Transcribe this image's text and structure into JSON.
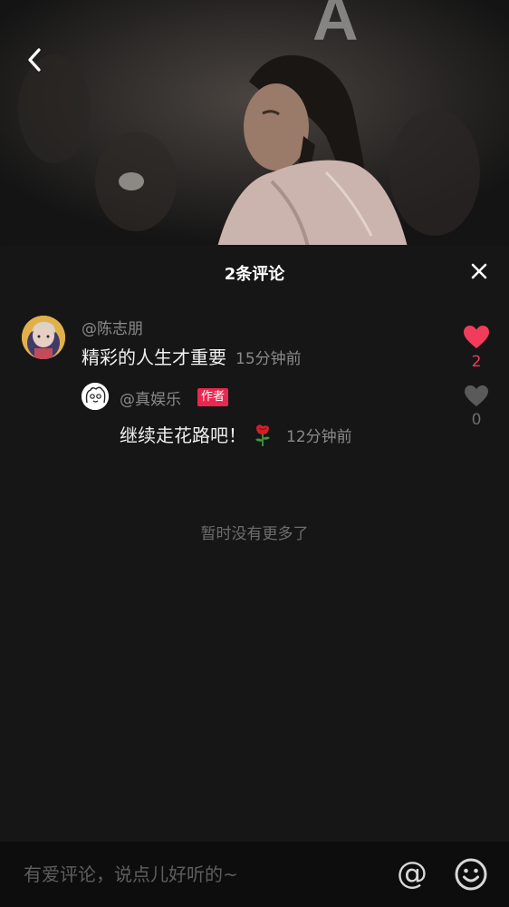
{
  "comments_sheet": {
    "title": "2条评论",
    "footer_note": "暂时没有更多了"
  },
  "comments": [
    {
      "username": "@陈志朋",
      "text": "精彩的人生才重要",
      "time": "15分钟前",
      "likes": "2",
      "liked": true,
      "like_color": "#f23c5c",
      "avatar_icon": "avatar-photo"
    }
  ],
  "reply": {
    "username": "@真娱乐",
    "badge": "作者",
    "text": "继续走花路吧！",
    "emoji": "rose-emoji",
    "time": "12分钟前",
    "likes": "0",
    "liked": false,
    "like_color": "#5a5a5a",
    "badge_color": "#e9284f",
    "avatar_icon": "cartoon-avatar"
  },
  "input_bar": {
    "placeholder": "有爱评论，说点儿好听的~",
    "mention_icon": "@"
  },
  "icons": {
    "back": "back-chevron-icon",
    "close": "close-icon",
    "emoji": "smiley-icon"
  }
}
